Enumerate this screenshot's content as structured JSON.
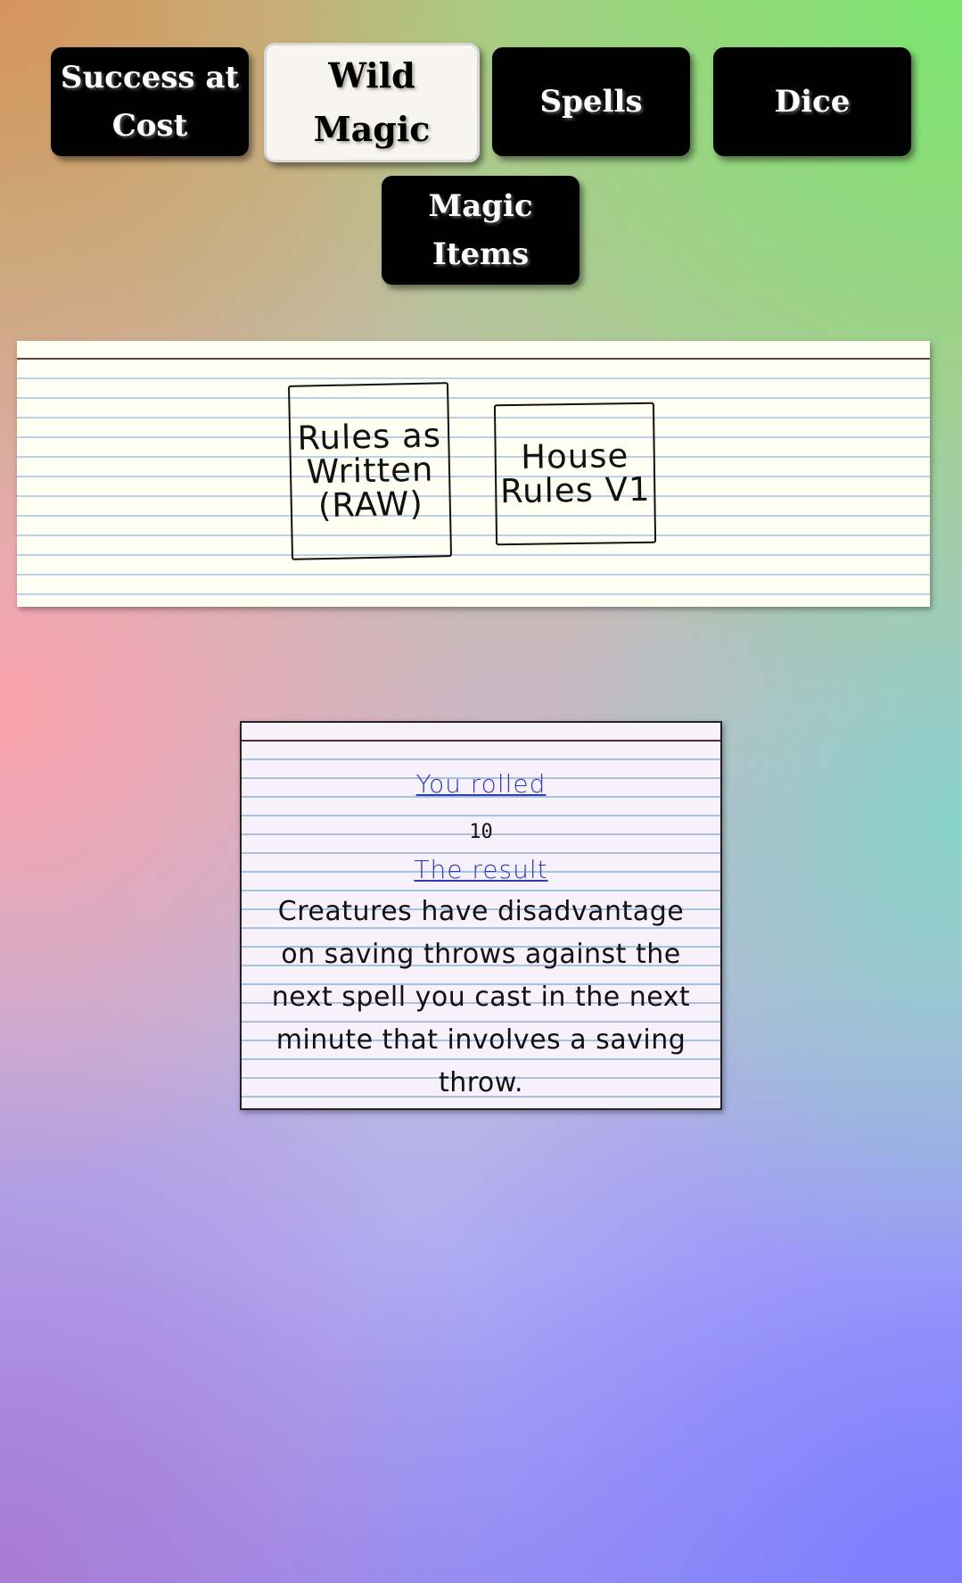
{
  "tabs": [
    {
      "label_line1": "Success at",
      "label_line2": "Cost",
      "active": false
    },
    {
      "label_line1": "Wild",
      "label_line2": "Magic",
      "active": true
    },
    {
      "label_line1": "Spells",
      "label_line2": "",
      "active": false
    },
    {
      "label_line1": "Dice",
      "label_line2": "",
      "active": false
    },
    {
      "label_line1": "Magic",
      "label_line2": "Items",
      "active": false
    }
  ],
  "mode_options": [
    {
      "line1": "Rules as",
      "line2": "Written",
      "line3": "(RAW)"
    },
    {
      "line1": "House",
      "line2": "Rules V1",
      "line3": ""
    }
  ],
  "result": {
    "rolled_label": "You rolled",
    "rolled_value": "10",
    "result_label": "The result",
    "result_text": "Creatures have disadvantage on saving throws against the next spell you cast in the next minute that involves a saving throw."
  }
}
